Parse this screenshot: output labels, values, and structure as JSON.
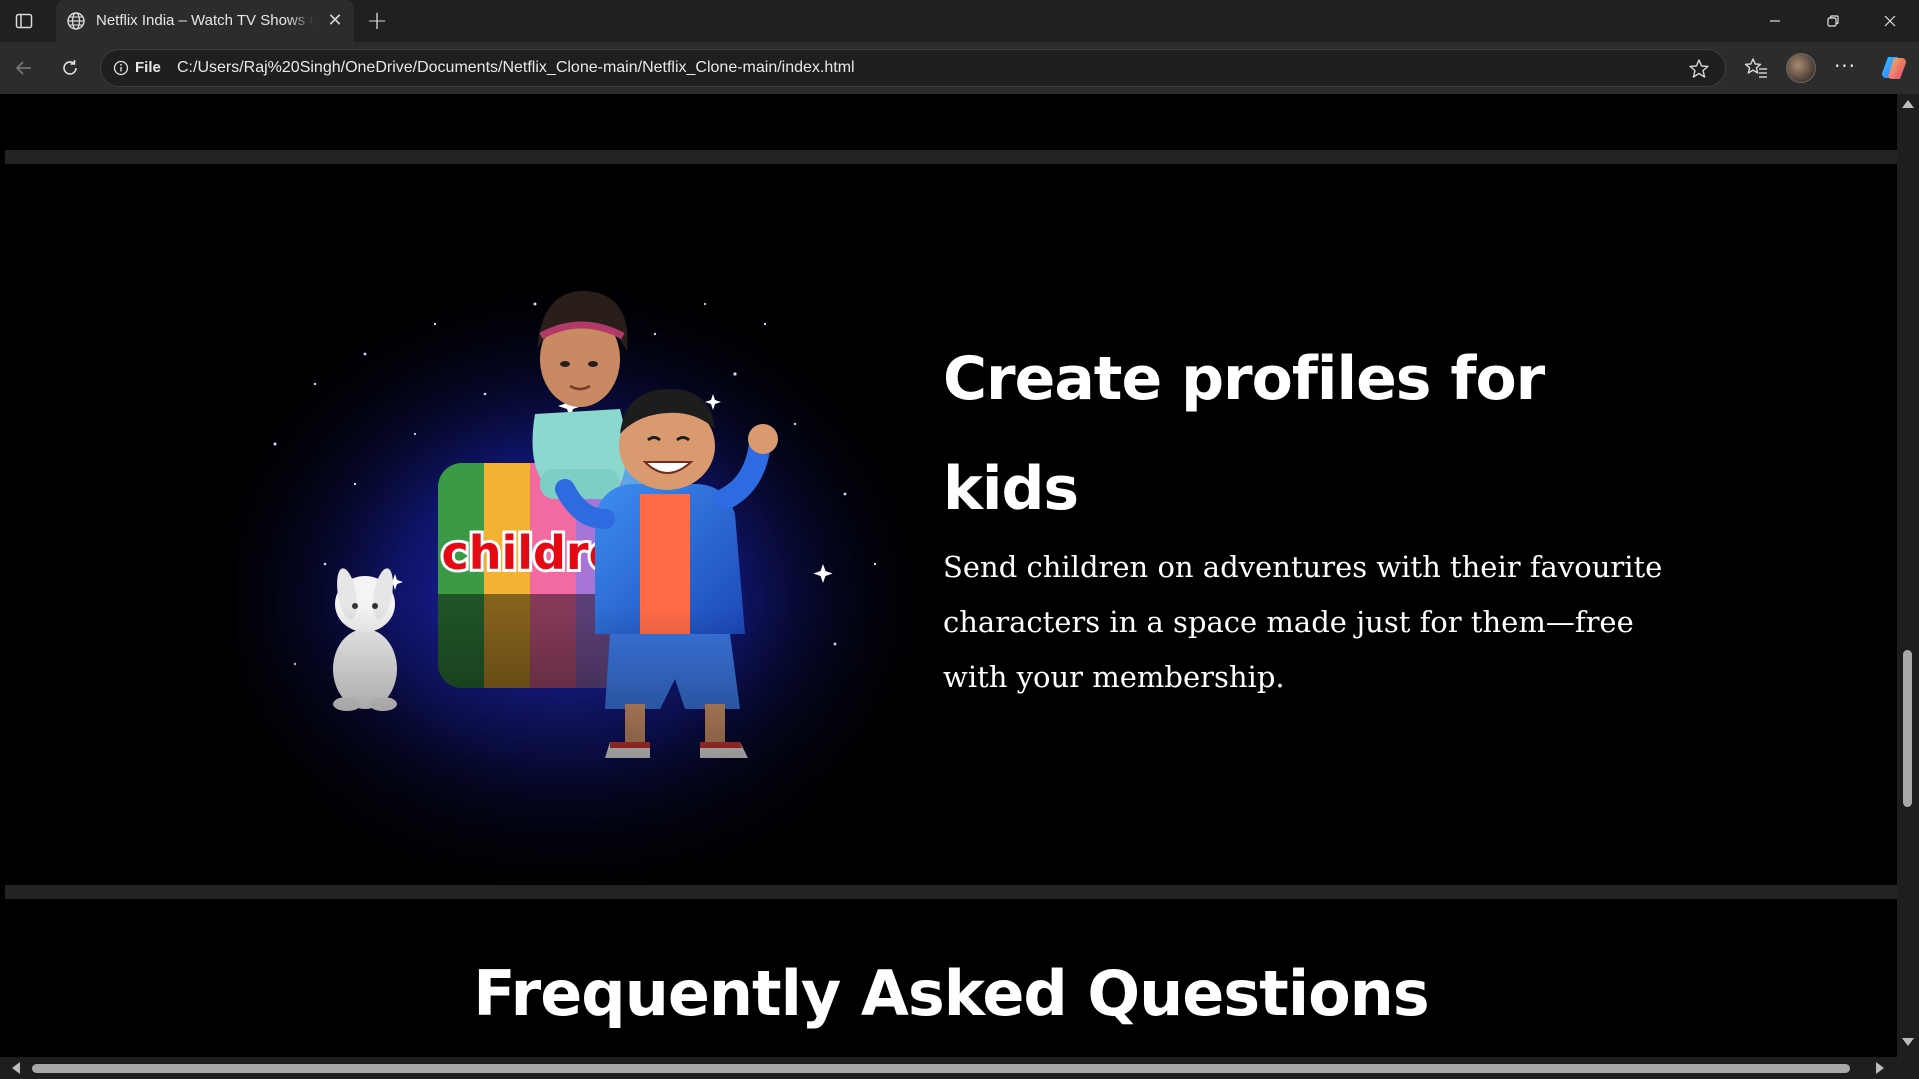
{
  "browser": {
    "tab": {
      "title": "Netflix India – Watch TV Shows Online",
      "close_glyph": "✕",
      "favicon": "globe-icon"
    },
    "new_tab_glyph": "+",
    "address": {
      "scheme_label": "File",
      "url": "C:/Users/Raj%20Singh/OneDrive/Documents/Netflix_Clone-main/Netflix_Clone-main/index.html"
    },
    "more_glyph": "···",
    "icons": [
      "tab-actions-icon",
      "back-arrow-icon",
      "reload-icon",
      "info-icon",
      "star-icon",
      "favorites-icon",
      "profile-avatar",
      "more-icon",
      "copilot-icon",
      "minimize-icon",
      "restore-icon",
      "close-icon"
    ]
  },
  "page": {
    "kids": {
      "heading": "Create profiles for kids",
      "description": "Send children on adventures with their favourite characters in a space made just for them—free with your membership.",
      "image_badge_text": "children",
      "badge_stripe_colors": [
        "#3a9a45",
        "#f2b233",
        "#f26aa2",
        "#a774d8",
        "#5ea6e8"
      ]
    },
    "faq": {
      "heading": "Frequently Asked Questions"
    }
  },
  "colors": {
    "chrome_bg": "#202020",
    "toolbar_bg": "#2c2c2c",
    "page_bg": "#000000",
    "divider": "#232323",
    "badge_red": "#e50914"
  }
}
